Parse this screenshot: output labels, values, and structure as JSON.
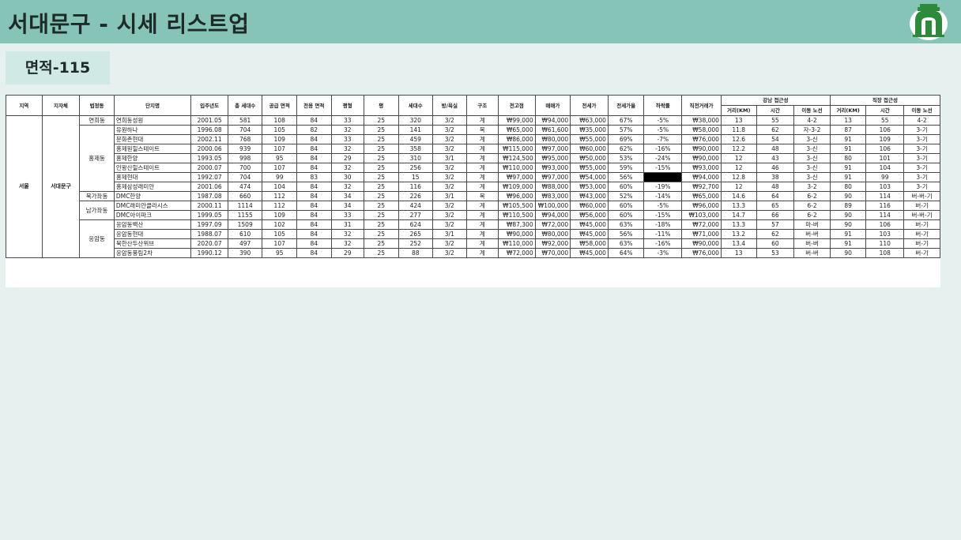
{
  "header": {
    "title": "서대문구 - 시세 리스트업",
    "bg_color": "#85c4b6",
    "logo_icon": "gate-logo-icon"
  },
  "subtitle": "면적-115",
  "table": {
    "headers": {
      "region": "지역",
      "city": "지자체",
      "dong": "법정동",
      "complex": "단지명",
      "year": "입주년도",
      "households_total": "총 세대수",
      "supply_area": "공급 면적",
      "exclusive_area": "전용 면적",
      "pyeong_type": "평형",
      "pyeong": "평",
      "households": "세대수",
      "rooms": "방/욕실",
      "structure": "구조",
      "prev_high": "전고점",
      "sale": "매매가",
      "jeonse": "전세가",
      "jeonse_ratio": "전세가율",
      "drop_rate": "하락률",
      "recent_trade": "직전거래가",
      "gangnam_group": "강남 접근성",
      "job_group": "직장 접근성",
      "distance": "거리(KM)",
      "time": "시간",
      "route": "이동 노선"
    },
    "region": "서울",
    "city": "서대문구",
    "dong_groups": [
      {
        "name": "연희동",
        "rows": 1
      },
      {
        "name": "홍제동",
        "rows": 7
      },
      {
        "name": "북가좌동",
        "rows": 1
      },
      {
        "name": "남가좌동",
        "rows": 2
      },
      {
        "name": "응암동",
        "rows": 4
      }
    ],
    "rows": [
      [
        "연희동성원",
        "2001.05",
        "581",
        "108",
        "84",
        "33",
        "25",
        "320",
        "3/2",
        "계",
        "₩99,000",
        "₩94,000",
        "₩63,000",
        "67%",
        "-5%",
        "₩38,000",
        "13",
        "55",
        "4-2",
        "13",
        "55",
        "4-2"
      ],
      [
        "유원하나",
        "1996.08",
        "704",
        "105",
        "82",
        "32",
        "25",
        "141",
        "3/2",
        "복",
        "₩65,000",
        "₩61,600",
        "₩35,000",
        "57%",
        "-5%",
        "₩58,000",
        "11.8",
        "62",
        "자-3-2",
        "87",
        "106",
        "3-기"
      ],
      [
        "문화촌현대",
        "2002.11",
        "768",
        "109",
        "84",
        "33",
        "25",
        "459",
        "3/2",
        "계",
        "₩86,000",
        "₩80,000",
        "₩55,000",
        "69%",
        "-7%",
        "₩76,000",
        "12.6",
        "54",
        "3-신",
        "91",
        "109",
        "3-기"
      ],
      [
        "홍제원힐스테이트",
        "2000.06",
        "939",
        "107",
        "84",
        "32",
        "25",
        "358",
        "3/2",
        "계",
        "₩115,000",
        "₩97,000",
        "₩60,000",
        "62%",
        "-16%",
        "₩90,000",
        "12.2",
        "48",
        "3-신",
        "91",
        "106",
        "3-기"
      ],
      [
        "홍제한양",
        "1993.05",
        "998",
        "95",
        "84",
        "29",
        "25",
        "310",
        "3/1",
        "계",
        "₩124,500",
        "₩95,000",
        "₩50,000",
        "53%",
        "-24%",
        "₩90,000",
        "12",
        "43",
        "3-신",
        "80",
        "101",
        "3-기"
      ],
      [
        "인왕산힐스테이트",
        "2000.07",
        "700",
        "107",
        "84",
        "32",
        "25",
        "256",
        "3/2",
        "계",
        "₩110,000",
        "₩93,000",
        "₩55,000",
        "59%",
        "-15%",
        "₩93,000",
        "12",
        "46",
        "3-신",
        "91",
        "104",
        "3-기"
      ],
      [
        "홍제현대",
        "1992.07",
        "704",
        "99",
        "83",
        "30",
        "25",
        "15",
        "3/2",
        "계",
        "₩97,000",
        "₩97,000",
        "₩54,000",
        "56%",
        "",
        "₩94,000",
        "12.8",
        "38",
        "3-신",
        "91",
        "99",
        "3-기"
      ],
      [
        "홍제삼성래미안",
        "2001.06",
        "474",
        "104",
        "84",
        "32",
        "25",
        "116",
        "3/2",
        "계",
        "₩109,000",
        "₩88,000",
        "₩53,000",
        "60%",
        "-19%",
        "₩92,700",
        "12",
        "48",
        "3-2",
        "80",
        "103",
        "3-기"
      ],
      [
        "DMC한양",
        "1987.08",
        "660",
        "112",
        "84",
        "34",
        "25",
        "226",
        "3/1",
        "복",
        "₩96,000",
        "₩83,000",
        "₩43,000",
        "52%",
        "-14%",
        "₩65,000",
        "14.6",
        "64",
        "6-2",
        "90",
        "114",
        "버-버-기"
      ],
      [
        "DMC래미안클라시스",
        "2000.11",
        "1114",
        "112",
        "84",
        "34",
        "25",
        "424",
        "3/2",
        "계",
        "₩105,500",
        "₩100,000",
        "₩60,000",
        "60%",
        "-5%",
        "₩96,000",
        "13.3",
        "65",
        "6-2",
        "89",
        "116",
        "버-기"
      ],
      [
        "DMC아이파크",
        "1999.05",
        "1155",
        "109",
        "84",
        "33",
        "25",
        "277",
        "3/2",
        "계",
        "₩110,500",
        "₩94,000",
        "₩56,000",
        "60%",
        "-15%",
        "₩103,000",
        "14.7",
        "66",
        "6-2",
        "90",
        "114",
        "버-버-기"
      ],
      [
        "응암동백산",
        "1997.09",
        "1509",
        "102",
        "84",
        "31",
        "25",
        "624",
        "3/2",
        "계",
        "₩87,300",
        "₩72,000",
        "₩45,000",
        "63%",
        "-18%",
        "₩72,000",
        "13.3",
        "57",
        "마-버",
        "90",
        "106",
        "버-기"
      ],
      [
        "응암동현대",
        "1988.07",
        "610",
        "105",
        "84",
        "32",
        "25",
        "265",
        "3/1",
        "계",
        "₩90,000",
        "₩80,000",
        "₩45,000",
        "56%",
        "-11%",
        "₩71,000",
        "13.2",
        "62",
        "버-버",
        "91",
        "103",
        "버-기"
      ],
      [
        "북한산두산위브",
        "2020.07",
        "497",
        "107",
        "84",
        "32",
        "25",
        "252",
        "3/2",
        "계",
        "₩110,000",
        "₩92,000",
        "₩58,000",
        "63%",
        "-16%",
        "₩90,000",
        "13.4",
        "60",
        "버-버",
        "91",
        "110",
        "버-기"
      ],
      [
        "응암동풍림2차",
        "1990.12",
        "390",
        "95",
        "84",
        "29",
        "25",
        "88",
        "3/2",
        "계",
        "₩72,000",
        "₩70,000",
        "₩45,000",
        "64%",
        "-3%",
        "₩76,000",
        "13",
        "53",
        "버-버",
        "90",
        "108",
        "버-기"
      ]
    ],
    "highlight_color": "#000000"
  }
}
